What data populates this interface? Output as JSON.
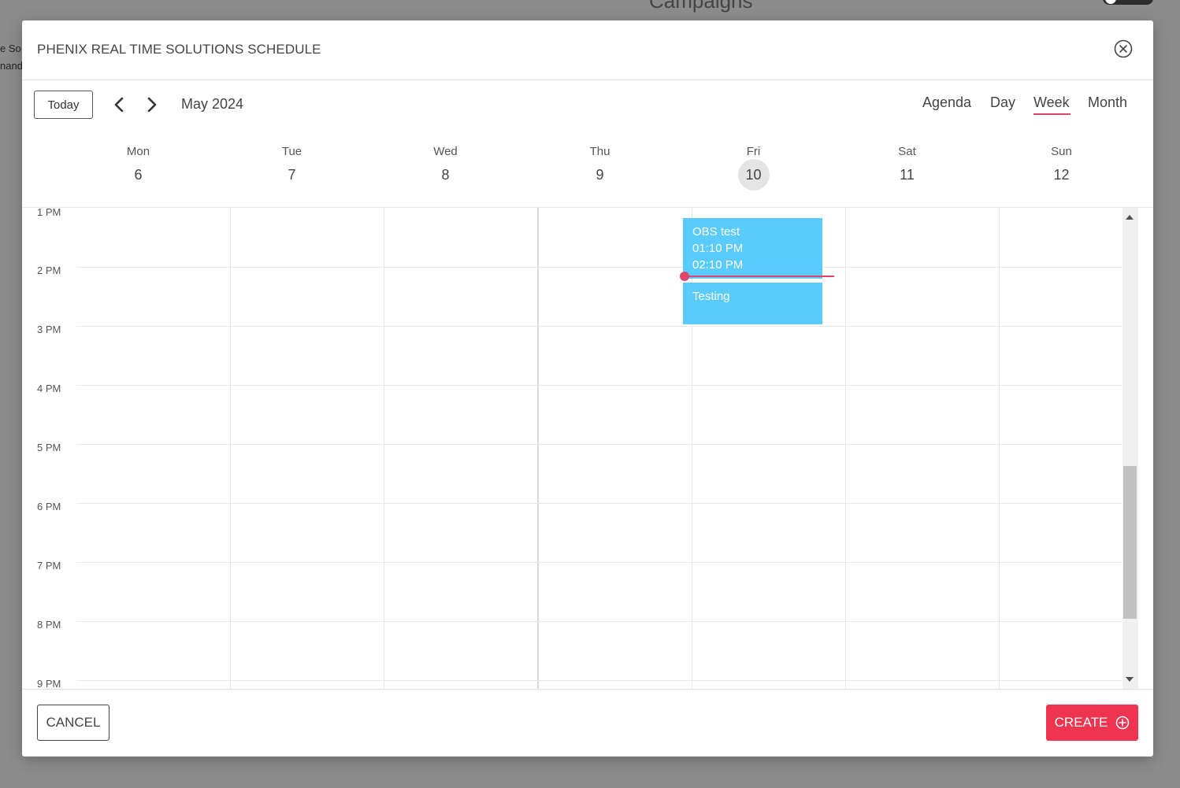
{
  "background": {
    "page_title": "Campaigns",
    "left_snippet_1": "e So",
    "left_snippet_2": "nand"
  },
  "modal": {
    "title": "PHENIX REAL TIME SOLUTIONS SCHEDULE",
    "close_icon": "close-circle-icon"
  },
  "toolbar": {
    "today_label": "Today",
    "prev_icon": "chevron-left-icon",
    "next_icon": "chevron-right-icon",
    "month_label": "May 2024",
    "views": [
      "Agenda",
      "Day",
      "Week",
      "Month"
    ],
    "active_view": "Week",
    "accent_color": "#e2456b"
  },
  "days": [
    {
      "name": "Mon",
      "num": "6"
    },
    {
      "name": "Tue",
      "num": "7"
    },
    {
      "name": "Wed",
      "num": "8"
    },
    {
      "name": "Thu",
      "num": "9"
    },
    {
      "name": "Fri",
      "num": "10",
      "is_today": true
    },
    {
      "name": "Sat",
      "num": "11"
    },
    {
      "name": "Sun",
      "num": "12"
    }
  ],
  "hours": [
    "1 PM",
    "2 PM",
    "3 PM",
    "4 PM",
    "5 PM",
    "6 PM",
    "7 PM",
    "8 PM",
    "9 PM"
  ],
  "events": [
    {
      "day": "Fri",
      "title": "OBS test",
      "start": "01:10 PM",
      "end": "02:10 PM",
      "color": "#59cbfc"
    },
    {
      "day": "Fri",
      "title": "Testing",
      "color": "#59cbfc"
    }
  ],
  "footer": {
    "cancel_label": "CANCEL",
    "create_label": "CREATE",
    "create_icon": "plus-circle-icon",
    "create_color": "#ee344f"
  }
}
